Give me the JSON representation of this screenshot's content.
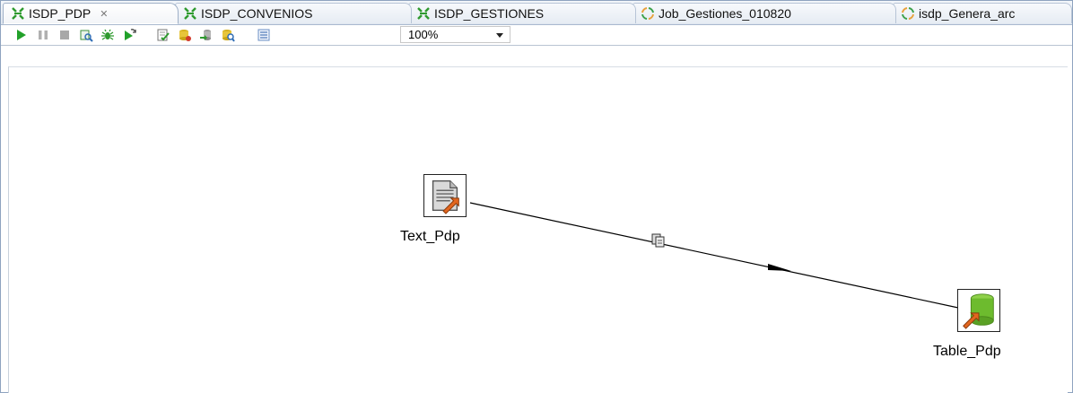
{
  "tabs": [
    {
      "label": "ISDP_PDP",
      "icon": "transformation-icon",
      "active": true,
      "closable": true
    },
    {
      "label": "ISDP_CONVENIOS",
      "icon": "transformation-icon",
      "active": false
    },
    {
      "label": "ISDP_GESTIONES",
      "icon": "transformation-icon",
      "active": false
    },
    {
      "label": "Job_Gestiones_010820",
      "icon": "job-icon",
      "active": false
    },
    {
      "label": "isdp_Genera_arc",
      "icon": "job-icon",
      "active": false
    }
  ],
  "toolbar": {
    "buttons": [
      "run-icon",
      "pause-icon",
      "stop-icon",
      "preview-icon",
      "debug-icon",
      "replay-icon",
      "verify-icon",
      "impact-icon",
      "sql-icon",
      "explore-db-icon",
      "layout-icon"
    ],
    "zoom": "100%"
  },
  "canvas": {
    "steps": [
      {
        "name": "Text_Pdp",
        "kind": "text-file-input-icon"
      },
      {
        "name": "Table_Pdp",
        "kind": "table-output-icon"
      }
    ],
    "hop": {
      "type": "copy",
      "icon": "copy-rows-icon"
    }
  },
  "colors": {
    "accent_green": "#2e9a2e",
    "job_orange": "#e8a13a",
    "tab_border": "#b7c4d6"
  }
}
